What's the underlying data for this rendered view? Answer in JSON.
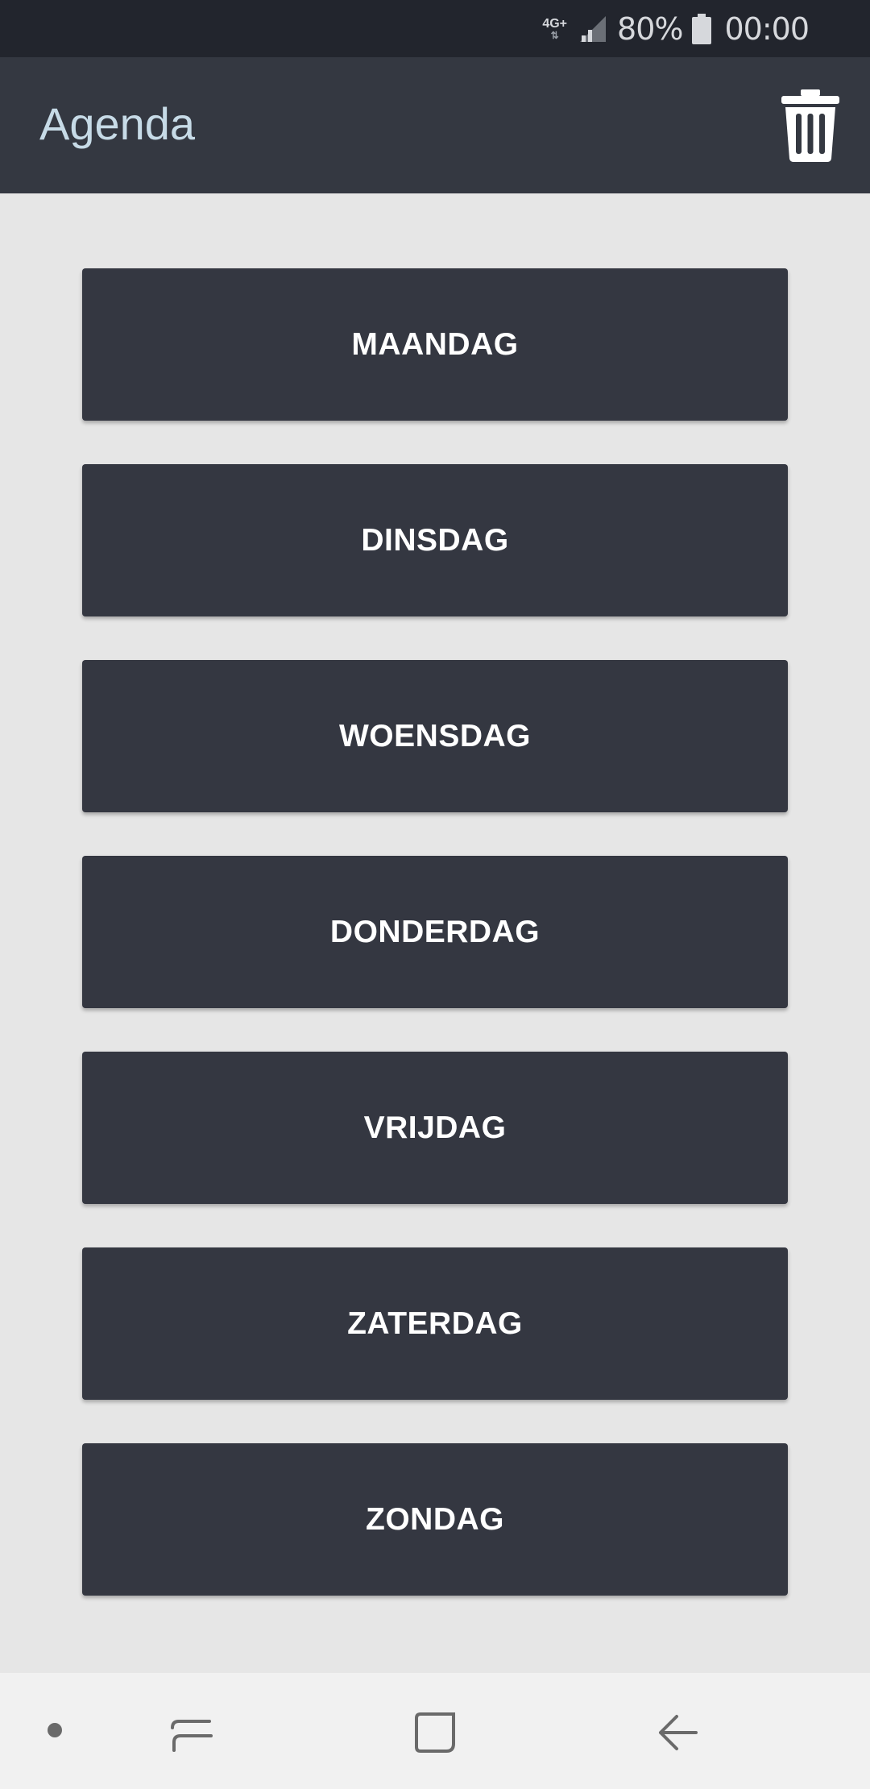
{
  "status_bar": {
    "network": "4G+",
    "battery": "80%",
    "time": "00:00",
    "icons": [
      "network-type-icon",
      "signal-icon",
      "battery-icon"
    ]
  },
  "app_bar": {
    "title": "Agenda",
    "action_icon": "trash-icon"
  },
  "days": [
    {
      "label": "MAANDAG"
    },
    {
      "label": "DINSDAG"
    },
    {
      "label": "WOENSDAG"
    },
    {
      "label": "DONDERDAG"
    },
    {
      "label": "VRIJDAG"
    },
    {
      "label": "ZATERDAG"
    },
    {
      "label": "ZONDAG"
    }
  ],
  "nav_bar": {
    "icons": [
      "nav-dot-icon",
      "recents-icon",
      "home-icon",
      "back-icon"
    ]
  },
  "colors": {
    "status_bar_bg": "#22252d",
    "app_bar_bg": "#343841",
    "title_color": "#c7dbe7",
    "button_bg": "#343741",
    "button_text": "#ffffff",
    "page_bg": "#e6e6e6",
    "nav_bar_bg": "#f1f1f1"
  }
}
